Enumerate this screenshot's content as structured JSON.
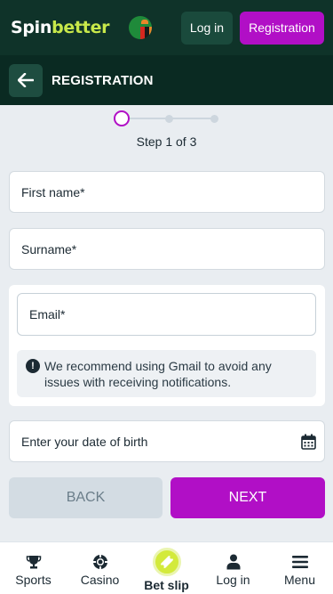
{
  "header": {
    "logo_part1": "Spin",
    "logo_part2": "better",
    "login_label": "Log in",
    "registration_label": "Registration"
  },
  "titlebar": {
    "title": "REGISTRATION"
  },
  "stepper": {
    "label": "Step 1 of 3",
    "current_step": 1,
    "total_steps": 3
  },
  "form": {
    "first_name_placeholder": "First name*",
    "surname_placeholder": "Surname*",
    "email_placeholder": "Email*",
    "email_notice": "We recommend using Gmail to avoid any issues with receiving notifications.",
    "dob_placeholder": "Enter your date of birth"
  },
  "actions": {
    "back_label": "BACK",
    "next_label": "NEXT"
  },
  "bottom_nav": {
    "items": [
      {
        "label": "Sports",
        "icon": "trophy-icon"
      },
      {
        "label": "Casino",
        "icon": "poker-chip-icon"
      },
      {
        "label": "Bet slip",
        "icon": "ticket-icon"
      },
      {
        "label": "Log in",
        "icon": "user-icon"
      },
      {
        "label": "Menu",
        "icon": "hamburger-menu-icon"
      }
    ]
  },
  "colors": {
    "brand_dark": "#0f3329",
    "accent_purple": "#b10fc6",
    "accent_lime": "#c8e84a"
  }
}
